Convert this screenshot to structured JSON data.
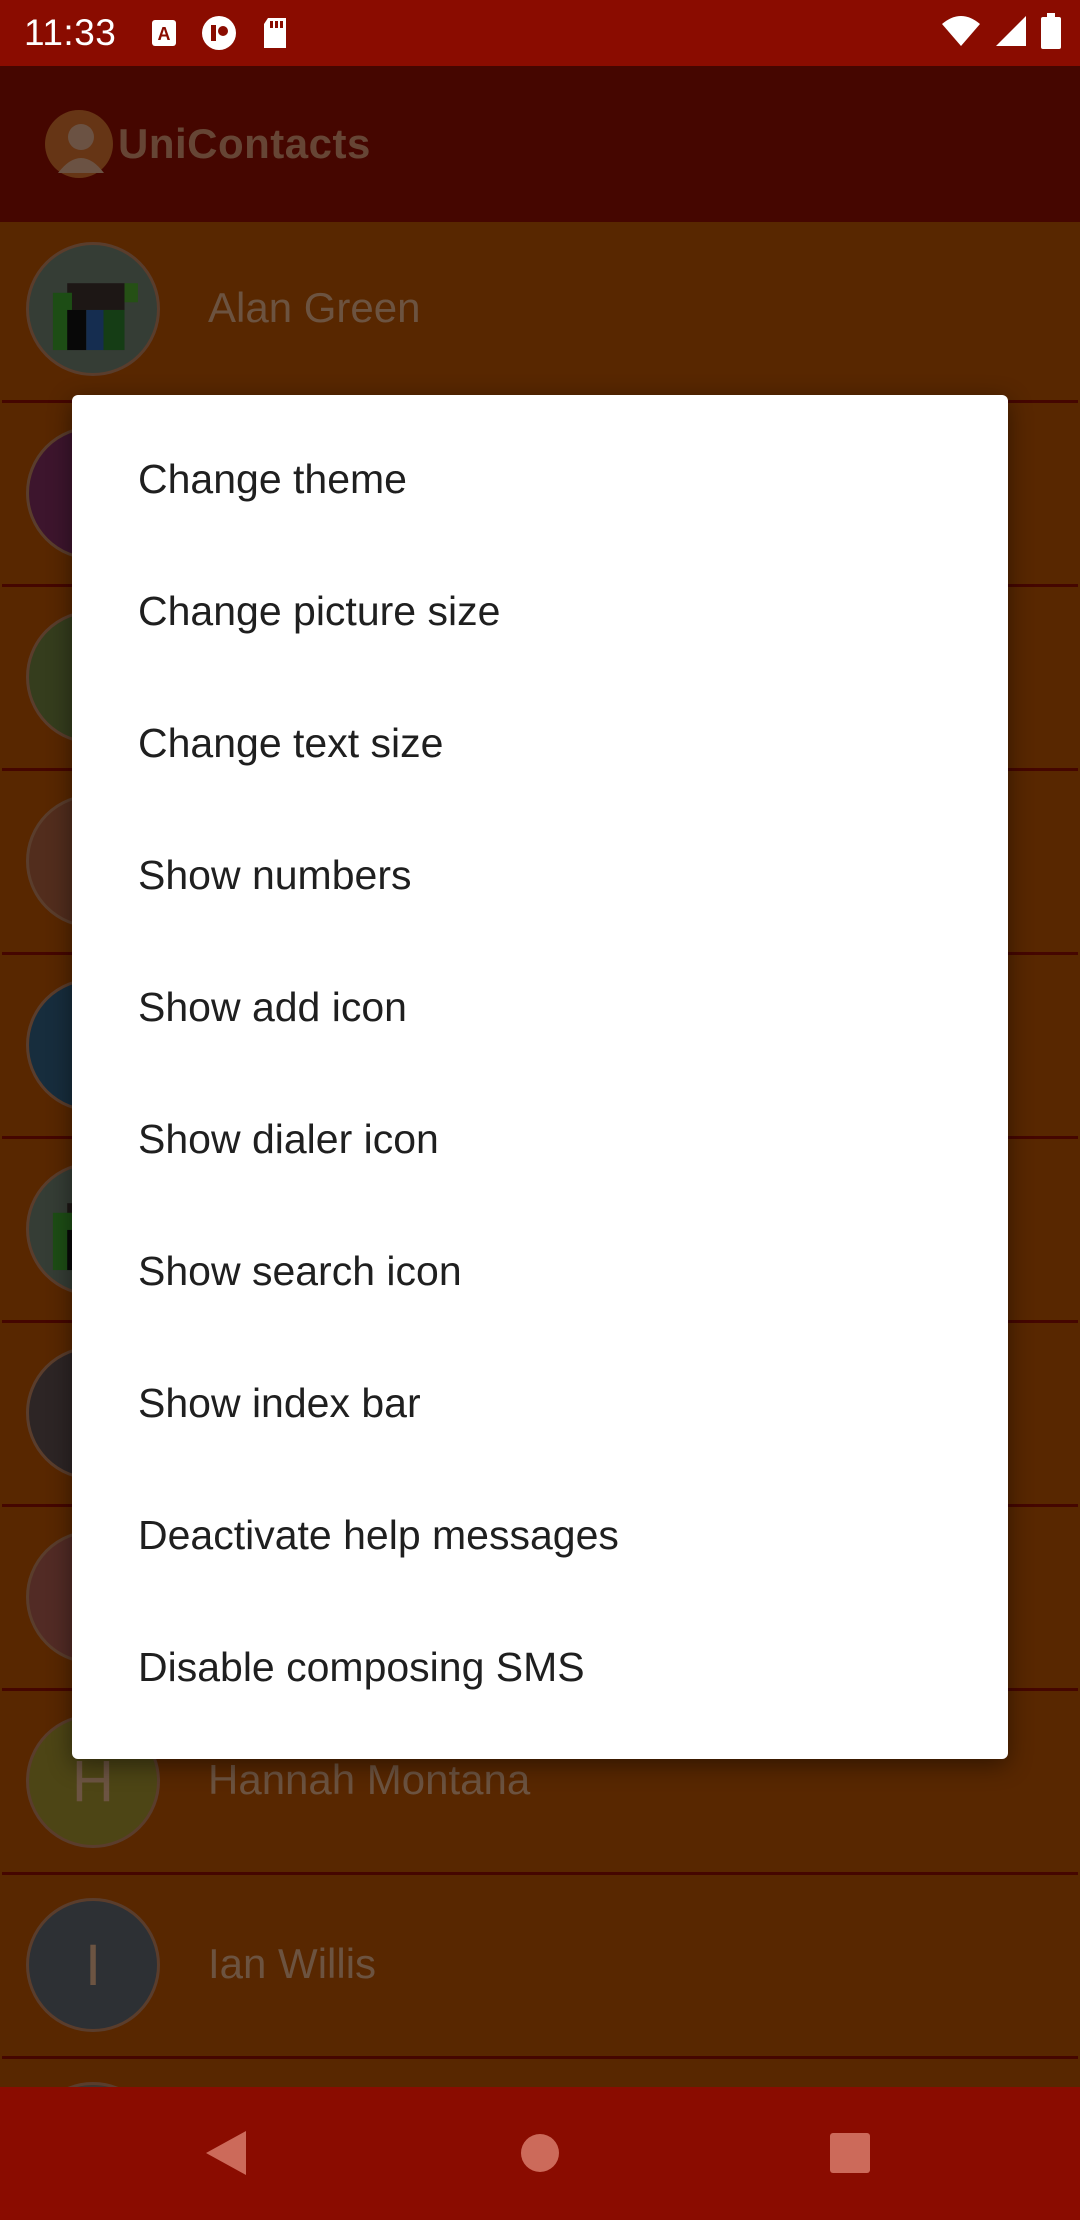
{
  "status_bar": {
    "time": "11:33",
    "left_icons": [
      "keyboard-a-icon",
      "app-notification-icon",
      "sd-card-icon"
    ],
    "right_icons": [
      "wifi-icon",
      "cellular-signal-icon",
      "battery-icon"
    ]
  },
  "app_bar": {
    "title": "UniContacts",
    "logo_icon": "person-icon"
  },
  "contacts": [
    {
      "name": "Alan Green",
      "avatar": "pixel-art",
      "avatar_color": "#6b7a6b"
    },
    {
      "name": "",
      "avatar": "color",
      "avatar_color": "#7a2a5a"
    },
    {
      "name": "",
      "avatar": "color",
      "avatar_color": "#6a7a3a"
    },
    {
      "name": "",
      "avatar": "color",
      "avatar_color": "#a55a3a"
    },
    {
      "name": "",
      "avatar": "color",
      "avatar_color": "#2f5a7a"
    },
    {
      "name": "",
      "avatar": "pixel-art",
      "avatar_color": "#6b7a6b"
    },
    {
      "name": "",
      "avatar": "color",
      "avatar_color": "#5a4a4a"
    },
    {
      "name": "",
      "avatar": "color",
      "avatar_color": "#a5574a"
    },
    {
      "name": "Hannah Montana",
      "avatar": "letter",
      "letter": "H",
      "avatar_color": "#9a8a2a"
    },
    {
      "name": "Ian Willis",
      "avatar": "letter",
      "letter": "I",
      "avatar_color": "#5a6068"
    }
  ],
  "menu": {
    "items": [
      "Change theme",
      "Change picture size",
      "Change text size",
      "Show numbers",
      "Show add icon",
      "Show dialer icon",
      "Show search icon",
      "Show index bar",
      "Deactivate help messages",
      "Disable composing SMS"
    ]
  },
  "nav_bar": {
    "icons": [
      "back-icon",
      "home-icon",
      "recents-icon"
    ]
  },
  "colors": {
    "status_bar": "#8a0c00",
    "list_background": "#b14f00",
    "menu_background": "#ffffff",
    "menu_text": "#1f1f1f"
  }
}
